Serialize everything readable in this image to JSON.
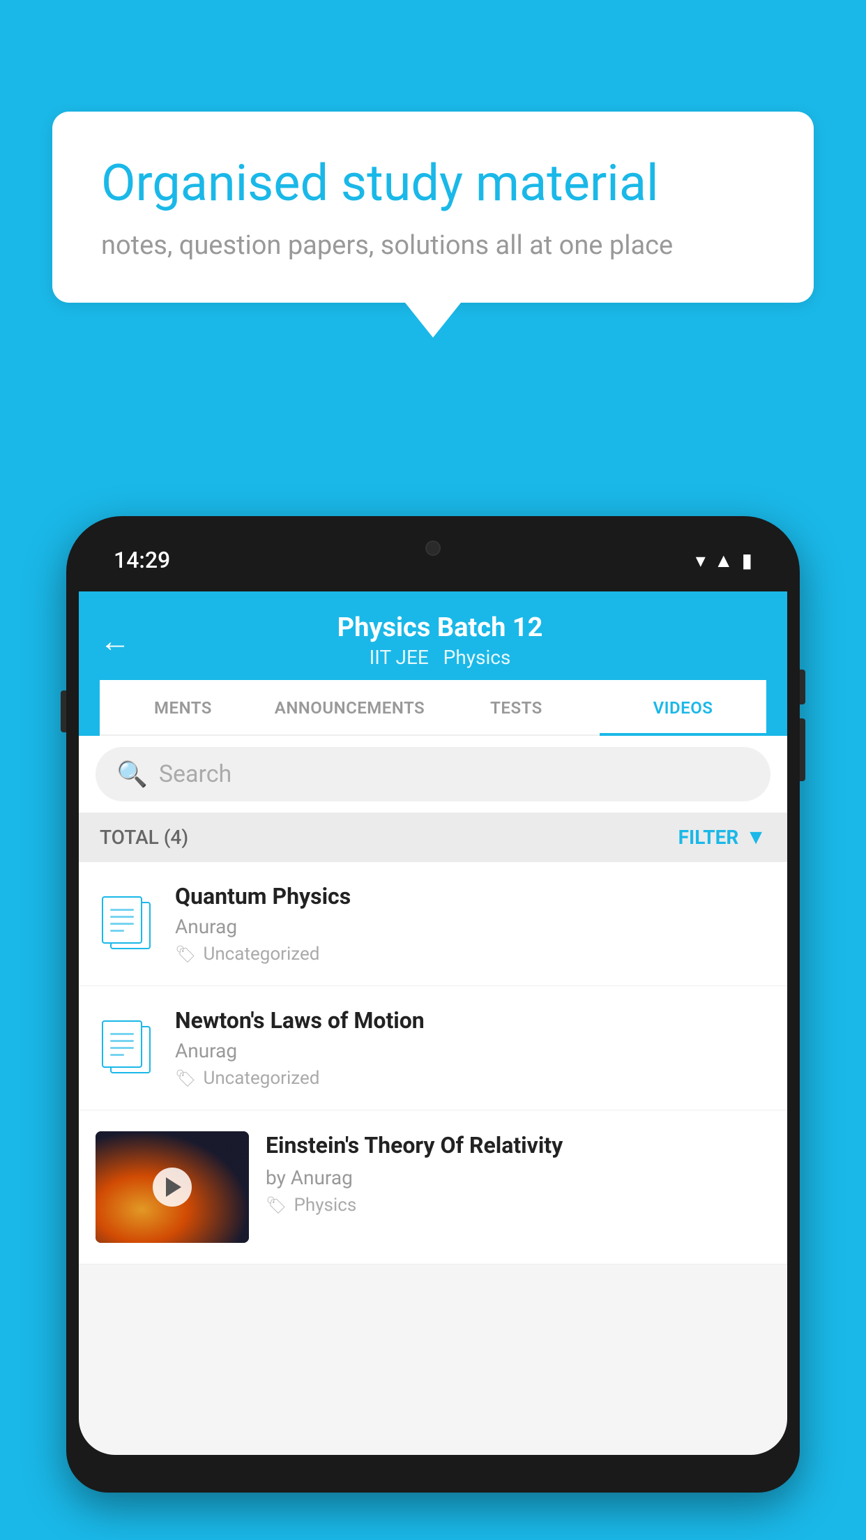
{
  "background_color": "#1ab8e8",
  "speech_bubble": {
    "title": "Organised study material",
    "subtitle": "notes, question papers, solutions all at one place"
  },
  "phone": {
    "status_bar": {
      "time": "14:29",
      "icons": [
        "wifi",
        "signal",
        "battery"
      ]
    },
    "header": {
      "back_label": "←",
      "title": "Physics Batch 12",
      "subtitle_parts": [
        "IIT JEE",
        "Physics"
      ]
    },
    "tabs": [
      {
        "label": "MENTS",
        "active": false
      },
      {
        "label": "ANNOUNCEMENTS",
        "active": false
      },
      {
        "label": "TESTS",
        "active": false
      },
      {
        "label": "VIDEOS",
        "active": true
      }
    ],
    "search": {
      "placeholder": "Search"
    },
    "filter_bar": {
      "total_label": "TOTAL (4)",
      "filter_label": "FILTER"
    },
    "videos": [
      {
        "id": 1,
        "title": "Quantum Physics",
        "author": "Anurag",
        "tag": "Uncategorized",
        "has_thumbnail": false
      },
      {
        "id": 2,
        "title": "Newton's Laws of Motion",
        "author": "Anurag",
        "tag": "Uncategorized",
        "has_thumbnail": false
      },
      {
        "id": 3,
        "title": "Einstein's Theory Of Relativity",
        "author": "by Anurag",
        "tag": "Physics",
        "has_thumbnail": true
      }
    ]
  }
}
